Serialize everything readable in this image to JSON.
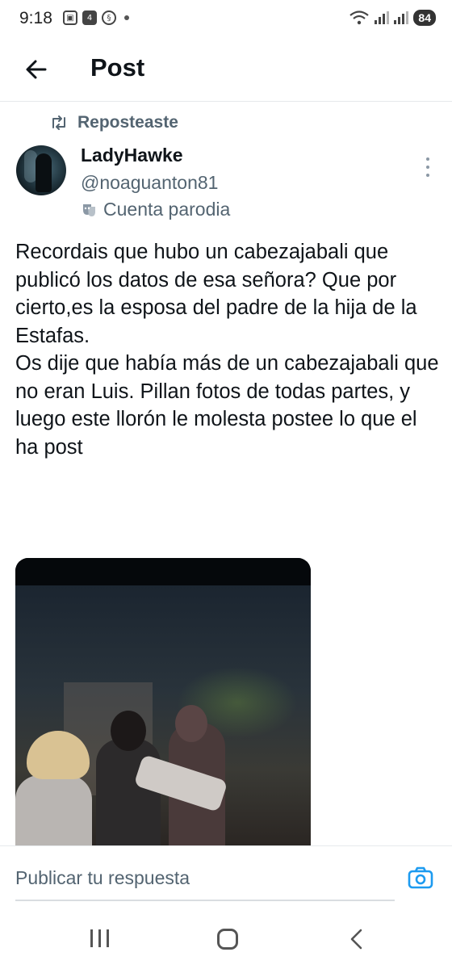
{
  "status_bar": {
    "time": "9:18",
    "battery": "84",
    "icons_left": [
      "screen-record-icon",
      "notification-4-icon",
      "cast-icon",
      "dot-icon"
    ],
    "icons_right": [
      "wifi-icon",
      "signal-icon",
      "signal-icon",
      "battery-icon"
    ]
  },
  "header": {
    "title": "Post",
    "back_icon": "arrow-left-icon"
  },
  "repost": {
    "label": "Reposteaste",
    "icon": "repost-icon"
  },
  "user": {
    "name": "LadyHawke",
    "handle": "@noaguanton81",
    "badge": "Cuenta parodia",
    "badge_icon": "theater-mask-icon"
  },
  "tweet": {
    "text_lines": [
      "Recordais que hubo un cabezajabali que publicó los datos de esa señora? Que por cierto,es la esposa del padre de la hija de la Estafas.",
      "Os dije que había más de un cabezajabali que no eran Luis. Pillan fotos de todas partes, y luego este llorón le molesta postee lo que el ha post"
    ]
  },
  "reply": {
    "placeholder": "Publicar tu respuesta",
    "camera_icon": "camera-icon"
  },
  "colors": {
    "text": "#0f1419",
    "secondary": "#536471",
    "accent": "#1d9bf0"
  }
}
